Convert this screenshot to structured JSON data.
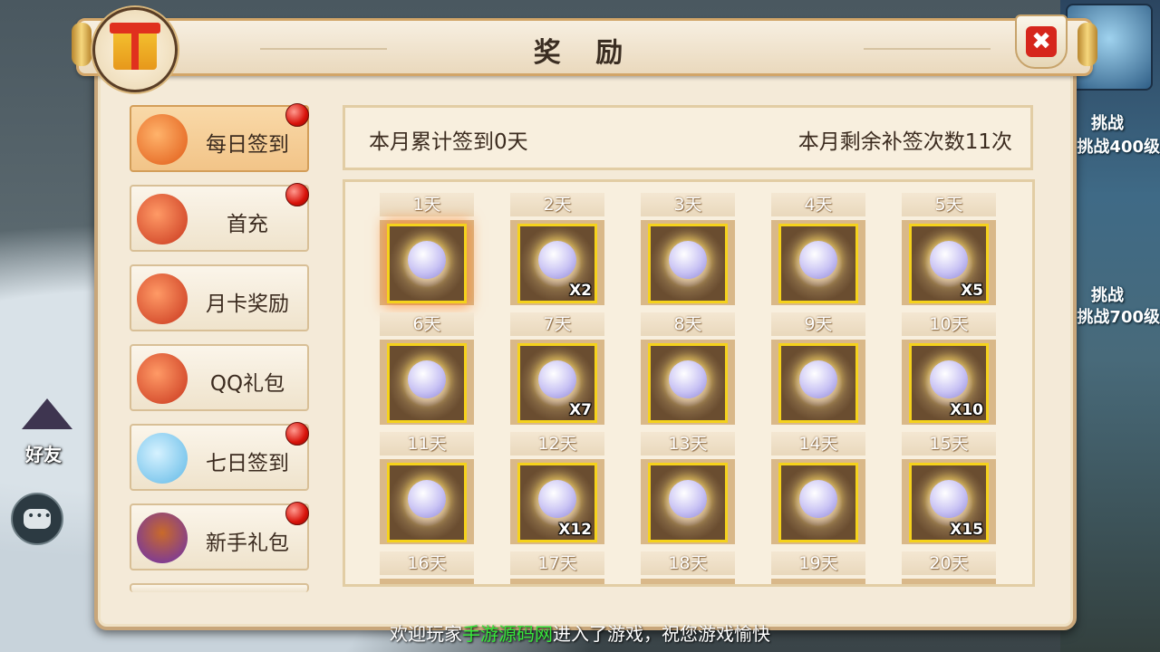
{
  "window": {
    "title": "奖 励"
  },
  "background": {
    "friend_label": "好友",
    "challenge_1": "挑战",
    "challenge_1_sub": "挑战400级",
    "challenge_2": "挑战",
    "challenge_2_sub": "挑战700级"
  },
  "tabs": [
    {
      "label": "每日签到",
      "active": true,
      "red_dot": true,
      "icon": "lantern-icon"
    },
    {
      "label": "首充",
      "active": false,
      "red_dot": true,
      "icon": "money-bag-icon"
    },
    {
      "label": "月卡奖励",
      "active": false,
      "red_dot": false,
      "icon": "money-bag-icon"
    },
    {
      "label": "QQ礼包",
      "active": false,
      "red_dot": false,
      "icon": "money-bag-icon"
    },
    {
      "label": "七日签到",
      "active": false,
      "red_dot": true,
      "icon": "blue-bag-icon"
    },
    {
      "label": "新手礼包",
      "active": false,
      "red_dot": true,
      "icon": "treasure-icon"
    }
  ],
  "info": {
    "signed_days": "本月累计签到0天",
    "makeup_left": "本月剩余补签次数11次"
  },
  "rewards": [
    {
      "day": "1天",
      "qty": ""
    },
    {
      "day": "2天",
      "qty": "X2"
    },
    {
      "day": "3天",
      "qty": ""
    },
    {
      "day": "4天",
      "qty": ""
    },
    {
      "day": "5天",
      "qty": "X5"
    },
    {
      "day": "6天",
      "qty": ""
    },
    {
      "day": "7天",
      "qty": "X7"
    },
    {
      "day": "8天",
      "qty": ""
    },
    {
      "day": "9天",
      "qty": ""
    },
    {
      "day": "10天",
      "qty": "X10"
    },
    {
      "day": "11天",
      "qty": ""
    },
    {
      "day": "12天",
      "qty": "X12"
    },
    {
      "day": "13天",
      "qty": ""
    },
    {
      "day": "14天",
      "qty": ""
    },
    {
      "day": "15天",
      "qty": "X15"
    },
    {
      "day": "16天",
      "qty": ""
    },
    {
      "day": "17天",
      "qty": ""
    },
    {
      "day": "18天",
      "qty": ""
    },
    {
      "day": "19天",
      "qty": ""
    },
    {
      "day": "20天",
      "qty": ""
    }
  ],
  "marquee": {
    "prefix": "欢迎玩家",
    "highlight": "手游源码网",
    "suffix": "进入了游戏，祝您游戏愉快"
  },
  "colors": {
    "accent": "#d6261c",
    "highlight_text": "#37e63a",
    "item_frame": "#f5d21c"
  }
}
